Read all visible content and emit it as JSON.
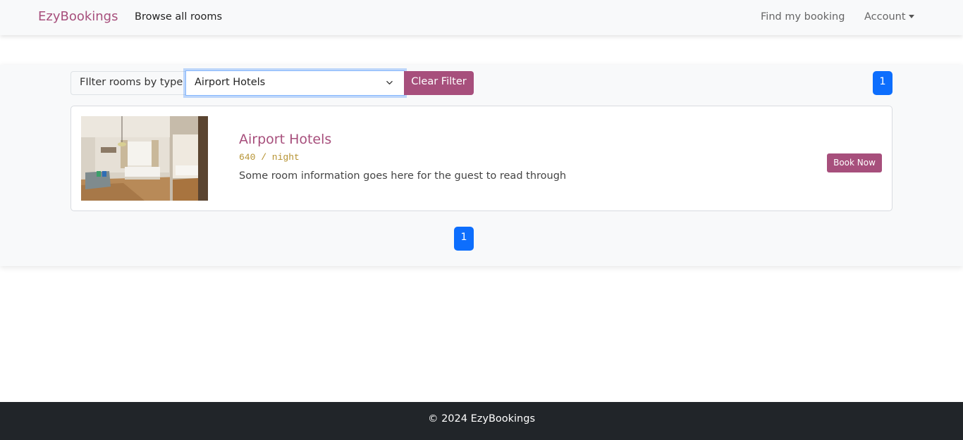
{
  "navbar": {
    "brand": "EzyBookings",
    "browse_label": "Browse all rooms",
    "find_booking_label": "Find my booking",
    "account_label": "Account"
  },
  "filter": {
    "label": "FIlter rooms by type",
    "selected_value": "Airport Hotels",
    "clear_label": "Clear Filter"
  },
  "pagination": {
    "top_page": "1",
    "bottom_page": "1"
  },
  "rooms": [
    {
      "title": "Airport Hotels",
      "price": "640 / night",
      "description": "Some room information goes here for the guest to read through",
      "book_label": "Book Now"
    }
  ],
  "footer": {
    "copyright": "© 2024 EzyBookings"
  },
  "colors": {
    "brand": "#a74f7c",
    "price": "#b5912f",
    "page_active": "#0d6efd",
    "footer_bg": "#212529"
  }
}
